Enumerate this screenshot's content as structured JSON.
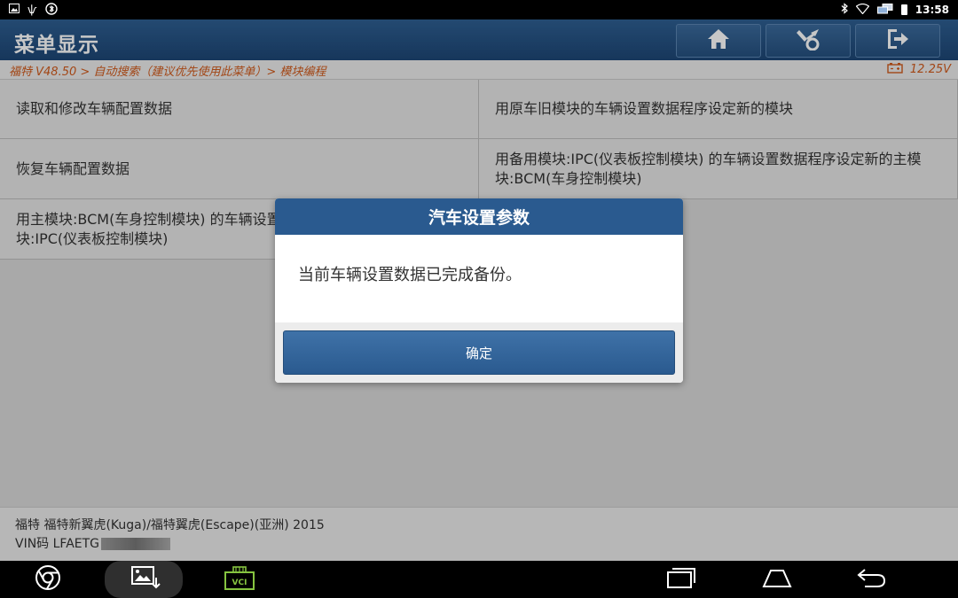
{
  "status_bar": {
    "left_icons": [
      "image-icon",
      "usb-icon",
      "bluetooth-settings-icon"
    ],
    "right_icons": [
      "bluetooth-icon",
      "wifi-icon",
      "network-icon",
      "battery-icon"
    ],
    "time": "13:58"
  },
  "header": {
    "title": "菜单显示",
    "buttons": [
      "home-icon",
      "diagnostic-tools-icon",
      "exit-icon"
    ]
  },
  "breadcrumb": {
    "path": "福特 V48.50 > 自动搜索（建议优先使用此菜单）> 模块编程",
    "voltage": "12.25V"
  },
  "menu": {
    "items": [
      {
        "label": "读取和修改车辆配置数据"
      },
      {
        "label": "用原车旧模块的车辆设置数据程序设定新的模块"
      },
      {
        "label": "恢复车辆配置数据"
      },
      {
        "label": "用备用模块:IPC(仪表板控制模块) 的车辆设置数据程序设定新的主模块:BCM(车身控制模块)"
      },
      {
        "label": "用主模块:BCM(车身控制模块) 的车辆设置数据程序设定新的备用模块:IPC(仪表板控制模块)"
      }
    ]
  },
  "dialog": {
    "title": "汽车设置参数",
    "message": "当前车辆设置数据已完成备份。",
    "ok_label": "确定"
  },
  "footer": {
    "vehicle": "福特 福特新翼虎(Kuga)/福特翼虎(Escape)(亚洲) 2015",
    "vin": "VIN码 LFAETG"
  },
  "nav_bar": {
    "buttons": [
      "browser-icon",
      "screenshot-icon",
      "vci-icon",
      "recent-apps-icon",
      "home-icon",
      "back-icon"
    ],
    "vci_label": "VCI"
  },
  "colors": {
    "header": "#1d4675",
    "accent": "#d05a1c",
    "dialog_title": "#2a5a8f"
  }
}
